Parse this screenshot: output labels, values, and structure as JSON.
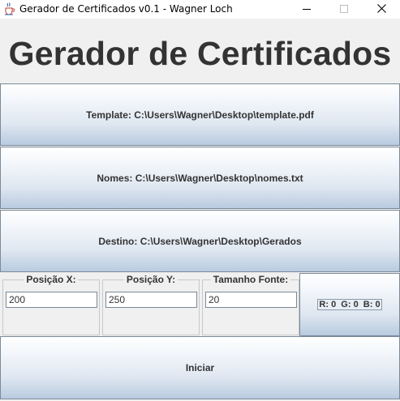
{
  "window": {
    "title": "Gerador de Certificados v0.1 - Wagner Loch",
    "app_icon": "java-cup-icon",
    "controls": [
      "minimize-icon",
      "maximize-icon",
      "close-icon"
    ]
  },
  "header": {
    "title": "Gerador de Certificados"
  },
  "buttons": {
    "template": "Template: C:\\Users\\Wagner\\Desktop\\template.pdf",
    "nomes": "Nomes: C:\\Users\\Wagner\\Desktop\\nomes.txt",
    "destino": "Destino: C:\\Users\\Wagner\\Desktop\\Gerados",
    "iniciar": "Iniciar"
  },
  "fields": {
    "posicao_x": {
      "label": "Posição X:",
      "value": "200"
    },
    "posicao_y": {
      "label": "Posição Y:",
      "value": "250"
    },
    "tamanho_fonte": {
      "label": "Tamanho Fonte:",
      "value": "20"
    }
  },
  "color": {
    "label": "R: 0  G: 0  B: 0",
    "value": "#000000"
  },
  "colors": {
    "button_top": "#ffffff",
    "button_bottom": "#b9cbe0",
    "button_border": "#7a8a99",
    "background": "#f0f0f0",
    "text": "#333333"
  }
}
